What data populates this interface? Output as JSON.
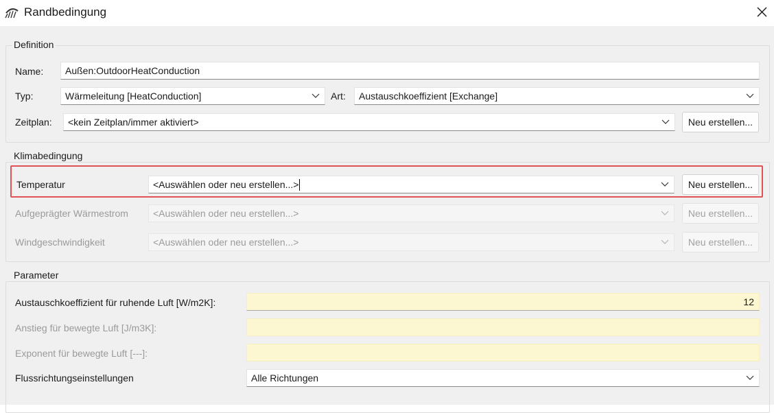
{
  "window": {
    "title": "Randbedingung",
    "app_icon": "boundary-condition-icon",
    "close_icon": "close-icon"
  },
  "definition": {
    "legend": "Definition",
    "name_label": "Name:",
    "name_value": "Außen:OutdoorHeatConduction",
    "type_label": "Typ:",
    "type_value": "Wärmeleitung [HeatConduction]",
    "kind_label": "Art:",
    "kind_value": "Austauschkoeffizient [Exchange]",
    "schedule_label": "Zeitplan:",
    "schedule_value": "<kein Zeitplan/immer aktiviert>",
    "schedule_new_button": "Neu erstellen..."
  },
  "climate": {
    "legend": "Klimabedingung",
    "rows": [
      {
        "label": "Temperatur",
        "value": "<Auswählen oder neu erstellen...>",
        "button": "Neu erstellen...",
        "enabled": true
      },
      {
        "label": "Aufgeprägter Wärmestrom",
        "value": "<Auswählen oder neu erstellen...>",
        "button": "Neu erstellen...",
        "enabled": false
      },
      {
        "label": "Windgeschwindigkeit",
        "value": "<Auswählen oder neu erstellen...>",
        "button": "Neu erstellen...",
        "enabled": false
      }
    ],
    "highlight_color": "#e05256"
  },
  "parameters": {
    "legend": "Parameter",
    "exchange_label": "Austauschkoeffizient für ruhende Luft [W/m2K]:",
    "exchange_value": "12",
    "slope_label": "Anstieg für bewegte Luft [J/m3K]:",
    "slope_value": "",
    "exponent_label": "Exponent für bewegte Luft [---]:",
    "exponent_value": "",
    "flow_label": "Flussrichtungseinstellungen",
    "flow_value": "Alle Richtungen"
  },
  "colors": {
    "dialog_background": "#f0f0f0",
    "input_highlight": "#fcf7d0"
  }
}
